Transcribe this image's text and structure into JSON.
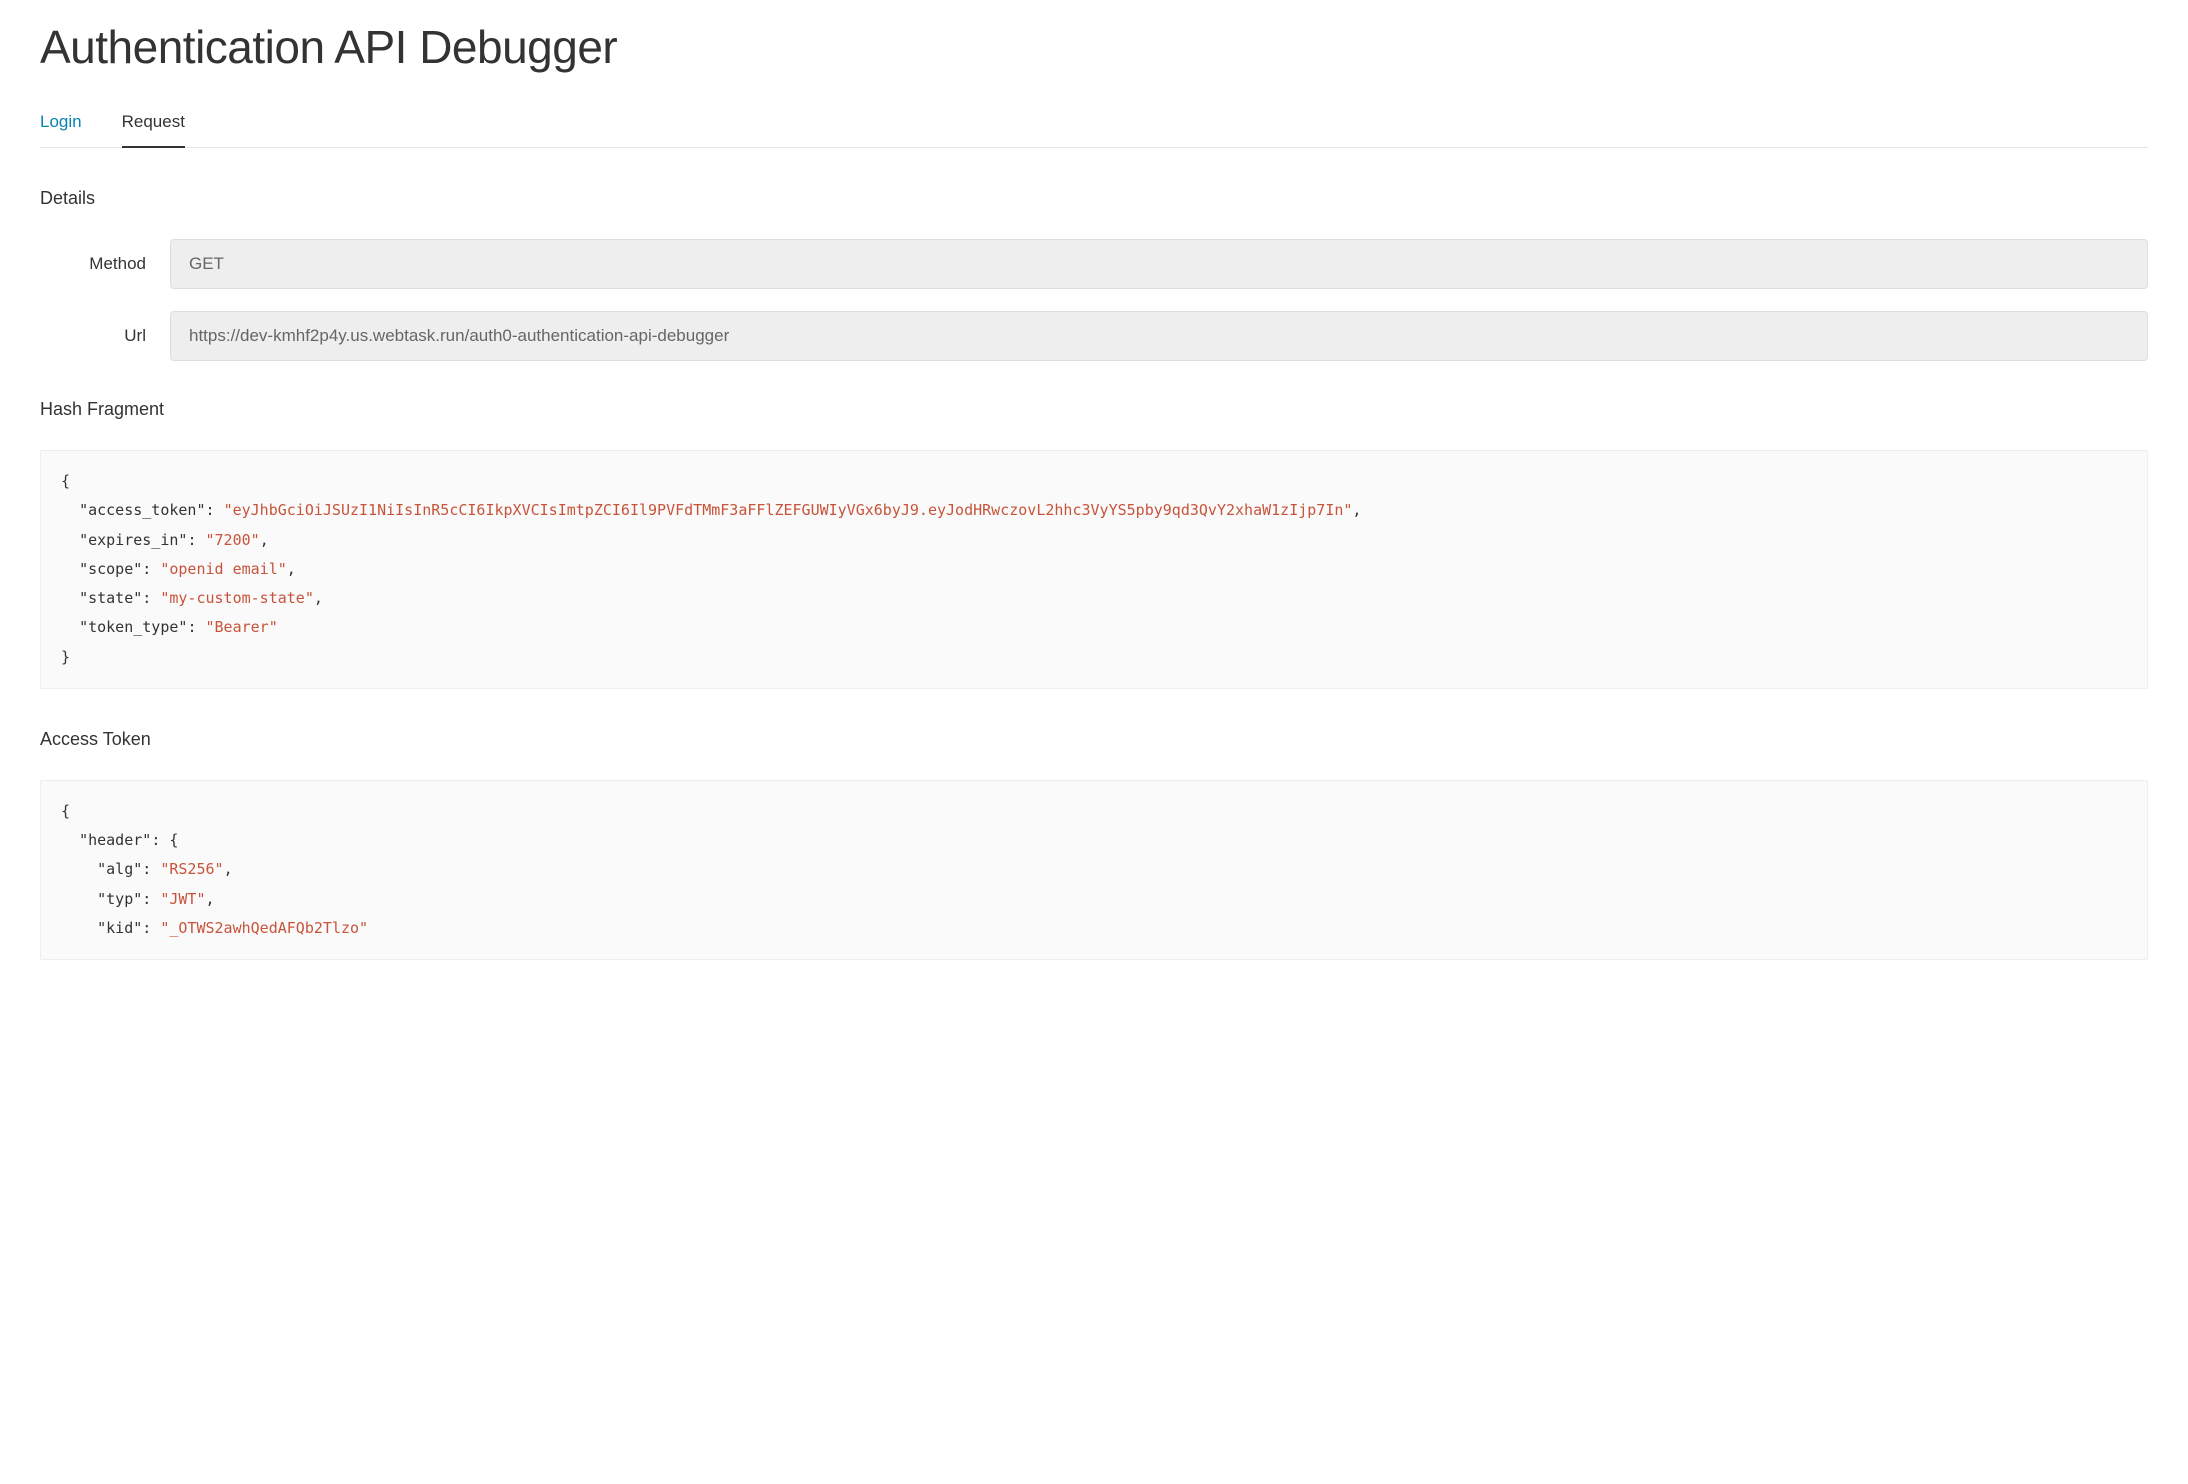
{
  "title": "Authentication API Debugger",
  "tabs": {
    "login": "Login",
    "request": "Request"
  },
  "details": {
    "heading": "Details",
    "method_label": "Method",
    "method_value": "GET",
    "url_label": "Url",
    "url_value": "https://dev-kmhf2p4y.us.webtask.run/auth0-authentication-api-debugger"
  },
  "hash_fragment": {
    "heading": "Hash Fragment",
    "data": {
      "access_token": "eyJhbGciOiJSUzI1NiIsInR5cCI6IkpXVCIsImtpZCI6Il9PVFdTMmF3aFFlZEFGUWIyVGx6byJ9.eyJodHRwczovL2hhc3VyYS5pby9qd3QvY2xhaW1zIjp7In",
      "expires_in": "7200",
      "scope": "openid email",
      "state": "my-custom-state",
      "token_type": "Bearer"
    }
  },
  "access_token": {
    "heading": "Access Token",
    "data": {
      "header": {
        "alg": "RS256",
        "typ": "JWT",
        "kid": "_OTWS2awhQedAFQb2Tlzo"
      }
    }
  }
}
